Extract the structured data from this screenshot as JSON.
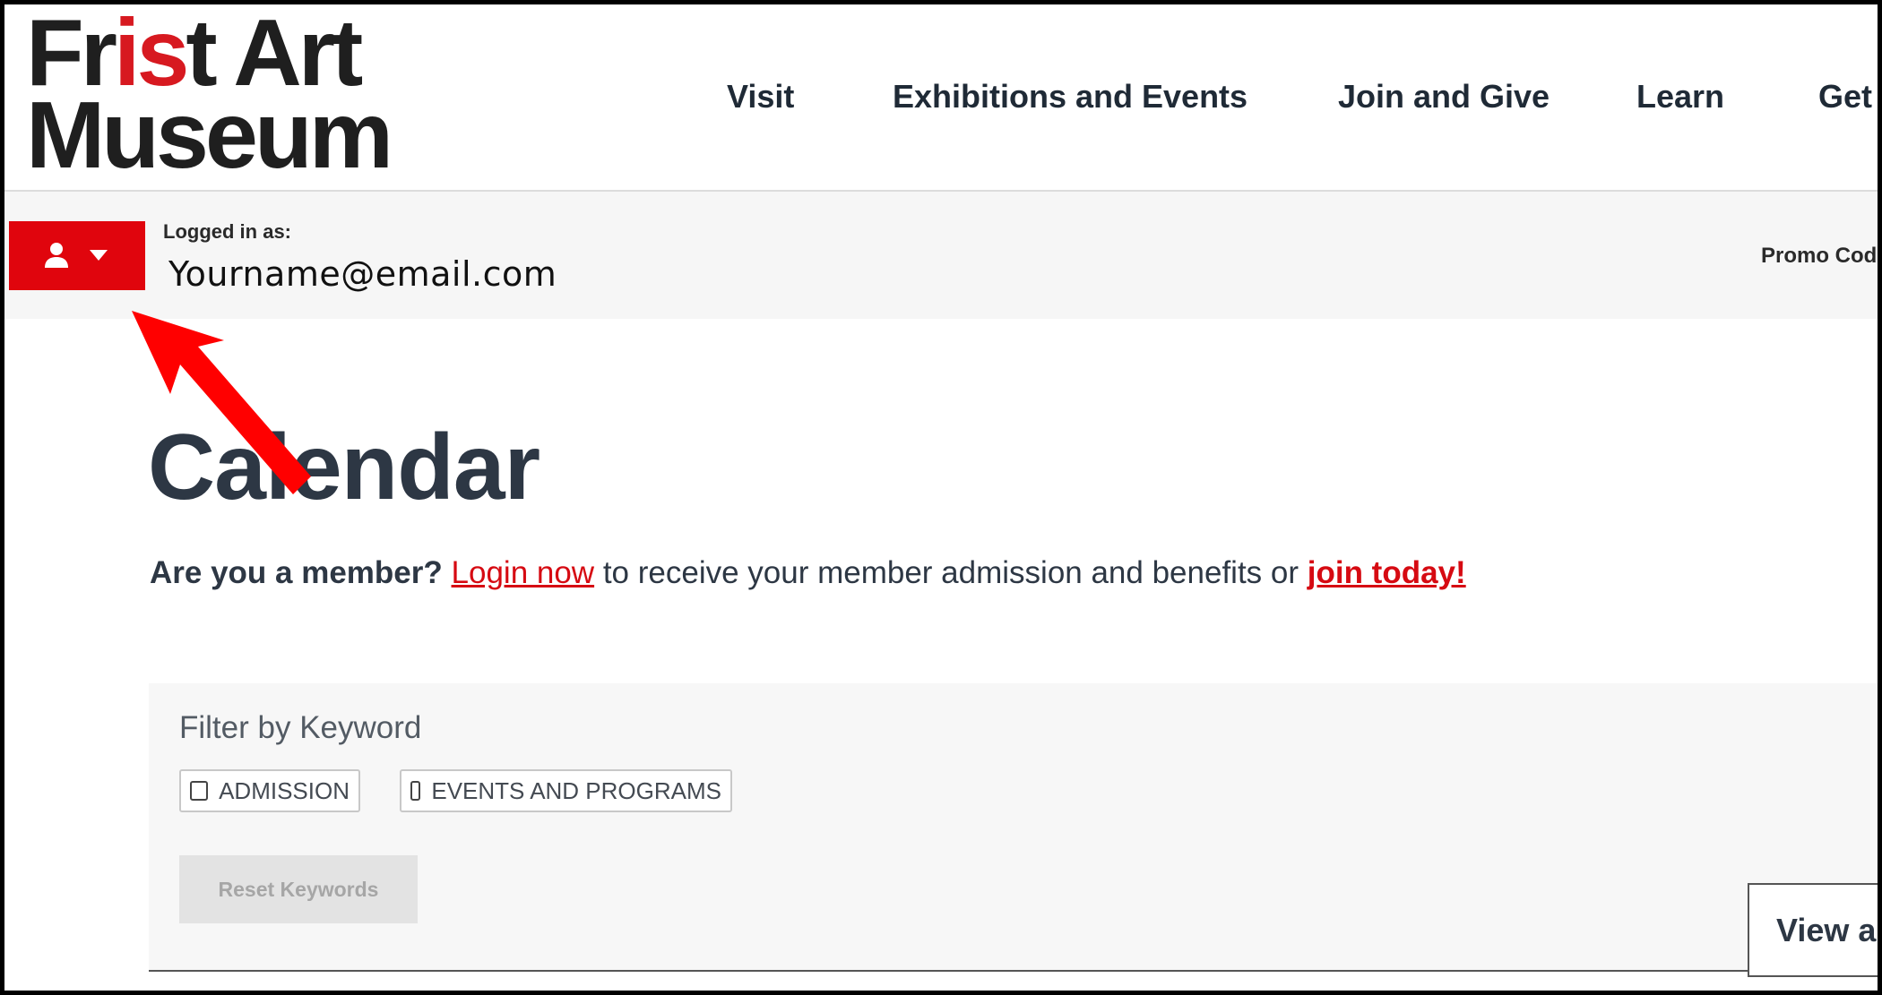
{
  "brand": {
    "logo_line1_pre": "Fr",
    "logo_line1_accent": "is",
    "logo_line1_post": "t Art",
    "logo_line2": "Museum",
    "accent_color": "#d71920"
  },
  "nav": {
    "items": [
      {
        "label": "Visit"
      },
      {
        "label": "Exhibitions and Events"
      },
      {
        "label": "Join and Give"
      },
      {
        "label": "Learn"
      },
      {
        "label": "Get"
      }
    ]
  },
  "account": {
    "button_color": "#e0050d",
    "icons": [
      "user-icon",
      "caret-down-icon"
    ],
    "logged_in_label": "Logged in as:",
    "email": "Yourname@email.com",
    "promo_code": "Promo Code"
  },
  "main": {
    "title": "Calendar",
    "member_prompt": {
      "question": "Are you a member?",
      "login_link": "Login now",
      "middle_text": " to receive your member admission and benefits or ",
      "join_link": "join today!"
    },
    "filter": {
      "title": "Filter by Keyword",
      "options": [
        {
          "label": "ADMISSION",
          "checked": false
        },
        {
          "label": "EVENTS AND PROGRAMS",
          "checked": false
        }
      ],
      "reset_label": "Reset Keywords"
    },
    "view_all_label": "View all"
  },
  "annotation": {
    "arrow_color": "#ff0000"
  }
}
